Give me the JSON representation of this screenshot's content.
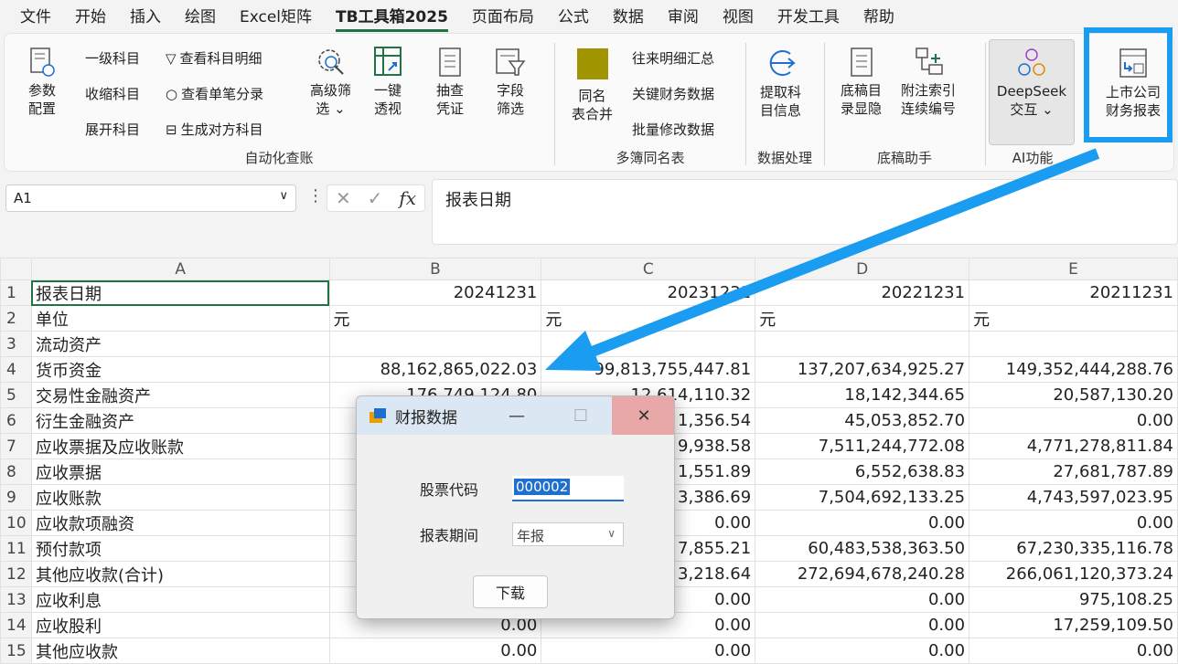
{
  "menu": [
    "文件",
    "开始",
    "插入",
    "绘图",
    "Excel矩阵",
    "TB工具箱2025",
    "页面布局",
    "公式",
    "数据",
    "审阅",
    "视图",
    "开发工具",
    "帮助"
  ],
  "ribbon": {
    "auto": {
      "label": "自动化查账",
      "param_l1": "参数",
      "param_l2": "配置",
      "lvl1": "一级科目",
      "collapse": "收缩科目",
      "expand": "展开科目",
      "view_detail": "查看科目明细",
      "view_single": "查看单笔分录",
      "gen_opposite": "生成对方科目",
      "adv_l1": "高级筛",
      "adv_l2": "选",
      "pivot_l1": "一键",
      "pivot_l2": "透视",
      "audit_l1": "抽查",
      "audit_l2": "凭证",
      "field_l1": "字段",
      "field_l2": "筛选"
    },
    "multi": {
      "label": "多簿同名表",
      "merge_l1": "同名",
      "merge_l2": "表合并",
      "summary": "往来明细汇总",
      "keydata": "关键财务数据",
      "batch": "批量修改数据"
    },
    "dp": {
      "label": "数据处理",
      "l1": "提取科",
      "l2": "目信息"
    },
    "draft": {
      "label": "底稿助手",
      "a1": "底稿目",
      "a2": "录显隐",
      "b1": "附注索引",
      "b2": "连续编号"
    },
    "ai": {
      "label": "AI功能",
      "l1": "DeepSeek",
      "l2": "交互"
    },
    "listed": {
      "l1": "上市公司",
      "l2": "财务报表"
    }
  },
  "formula": {
    "cell": "A1",
    "content": "报表日期",
    "fx": "fx"
  },
  "sheet": {
    "columns": [
      "A",
      "B",
      "C",
      "D",
      "E"
    ],
    "rows": [
      {
        "n": "1",
        "a": "报表日期",
        "b": "20241231",
        "c": "20231231",
        "d": "20221231",
        "e": "20211231"
      },
      {
        "n": "2",
        "a": "单位",
        "b": "元",
        "c": "元",
        "d": "元",
        "e": "元"
      },
      {
        "n": "3",
        "a": "流动资产",
        "b": "",
        "c": "",
        "d": "",
        "e": ""
      },
      {
        "n": "4",
        "a": "货币资金",
        "b": "88,162,865,022.03",
        "c": "99,813,755,447.81",
        "d": "137,207,634,925.27",
        "e": "149,352,444,288.76"
      },
      {
        "n": "5",
        "a": "交易性金融资产",
        "b": "176,749,124.80",
        "c": "12,614,110.32",
        "d": "18,142,344.65",
        "e": "20,587,130.20"
      },
      {
        "n": "6",
        "a": "衍生金融资产",
        "b": "",
        "c": "1,356.54",
        "d": "45,053,852.70",
        "e": "0.00"
      },
      {
        "n": "7",
        "a": "应收票据及应收账款",
        "b": "",
        "c": "9,938.58",
        "d": "7,511,244,772.08",
        "e": "4,771,278,811.84"
      },
      {
        "n": "8",
        "a": "应收票据",
        "b": "",
        "c": "1,551.89",
        "d": "6,552,638.83",
        "e": "27,681,787.89"
      },
      {
        "n": "9",
        "a": "应收账款",
        "b": "",
        "c": "3,386.69",
        "d": "7,504,692,133.25",
        "e": "4,743,597,023.95"
      },
      {
        "n": "10",
        "a": "应收款项融资",
        "b": "",
        "c": "0.00",
        "d": "0.00",
        "e": "0.00"
      },
      {
        "n": "11",
        "a": "预付款项",
        "b": "",
        "c": "7,855.21",
        "d": "60,483,538,363.50",
        "e": "67,230,335,116.78"
      },
      {
        "n": "12",
        "a": "其他应收款(合计)",
        "b": "",
        "c": "3,218.64",
        "d": "272,694,678,240.28",
        "e": "266,061,120,373.24"
      },
      {
        "n": "13",
        "a": "应收利息",
        "b": "",
        "c": "0.00",
        "d": "0.00",
        "e": "975,108.25"
      },
      {
        "n": "14",
        "a": "应收股利",
        "b": "0.00",
        "c": "0.00",
        "d": "0.00",
        "e": "17,259,109.50"
      },
      {
        "n": "15",
        "a": "其他应收款",
        "b": "0.00",
        "c": "0.00",
        "d": "0.00",
        "e": "0.00"
      }
    ]
  },
  "dialog": {
    "title": "财报数据",
    "stock_label": "股票代码",
    "stock_value": "000002",
    "period_label": "报表期间",
    "period_value": "年报",
    "download": "下载"
  },
  "colors": {
    "highlight": "#1a9cf0",
    "accent": "#217346"
  }
}
